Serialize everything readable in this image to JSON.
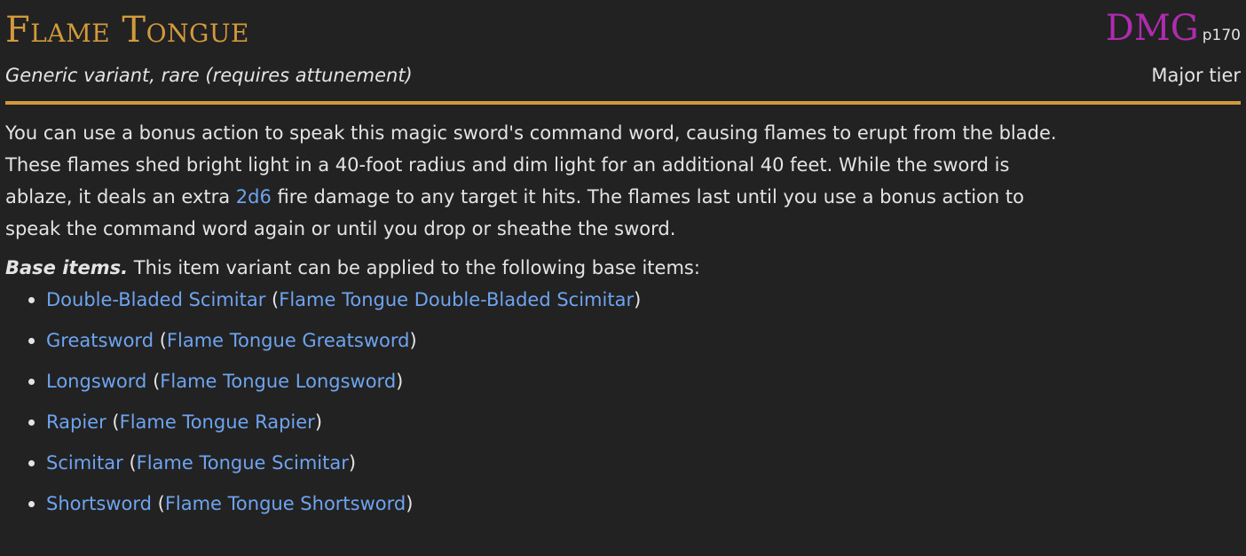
{
  "item": {
    "name": "Flame Tongue",
    "source_abbr": "DMG",
    "source_page": "p170",
    "subtitle": "Generic variant, rare (requires attunement)",
    "tier": "Major tier"
  },
  "description": {
    "line1": "You can use a bonus action to speak this magic sword's command word, causing flames to erupt from the blade.",
    "line2": "These flames shed bright light in a 40-foot radius and dim light for an additional 40 feet. While the sword is",
    "line3_before": "ablaze, it deals an extra ",
    "dice": "2d6",
    "line3_after": " fire damage to any target it hits. The flames last until you use a bonus action to",
    "line4": "speak the command word again or until you drop or sheathe the sword."
  },
  "base_items": {
    "label": "Base items.",
    "intro": " This item variant can be applied to the following base items:",
    "open_paren": "(",
    "close_paren": ")",
    "list": [
      {
        "base": "Double-Bladed Scimitar",
        "variant": "Flame Tongue Double-Bladed Scimitar"
      },
      {
        "base": "Greatsword",
        "variant": "Flame Tongue Greatsword"
      },
      {
        "base": "Longsword",
        "variant": "Flame Tongue Longsword"
      },
      {
        "base": "Rapier",
        "variant": "Flame Tongue Rapier"
      },
      {
        "base": "Scimitar",
        "variant": "Flame Tongue Scimitar"
      },
      {
        "base": "Shortsword",
        "variant": "Flame Tongue Shortsword"
      }
    ]
  },
  "colors": {
    "background": "#222222",
    "title": "#d29a3c",
    "source": "#b02bb0",
    "link": "#6ea4f0",
    "text": "#e4e4e4"
  }
}
